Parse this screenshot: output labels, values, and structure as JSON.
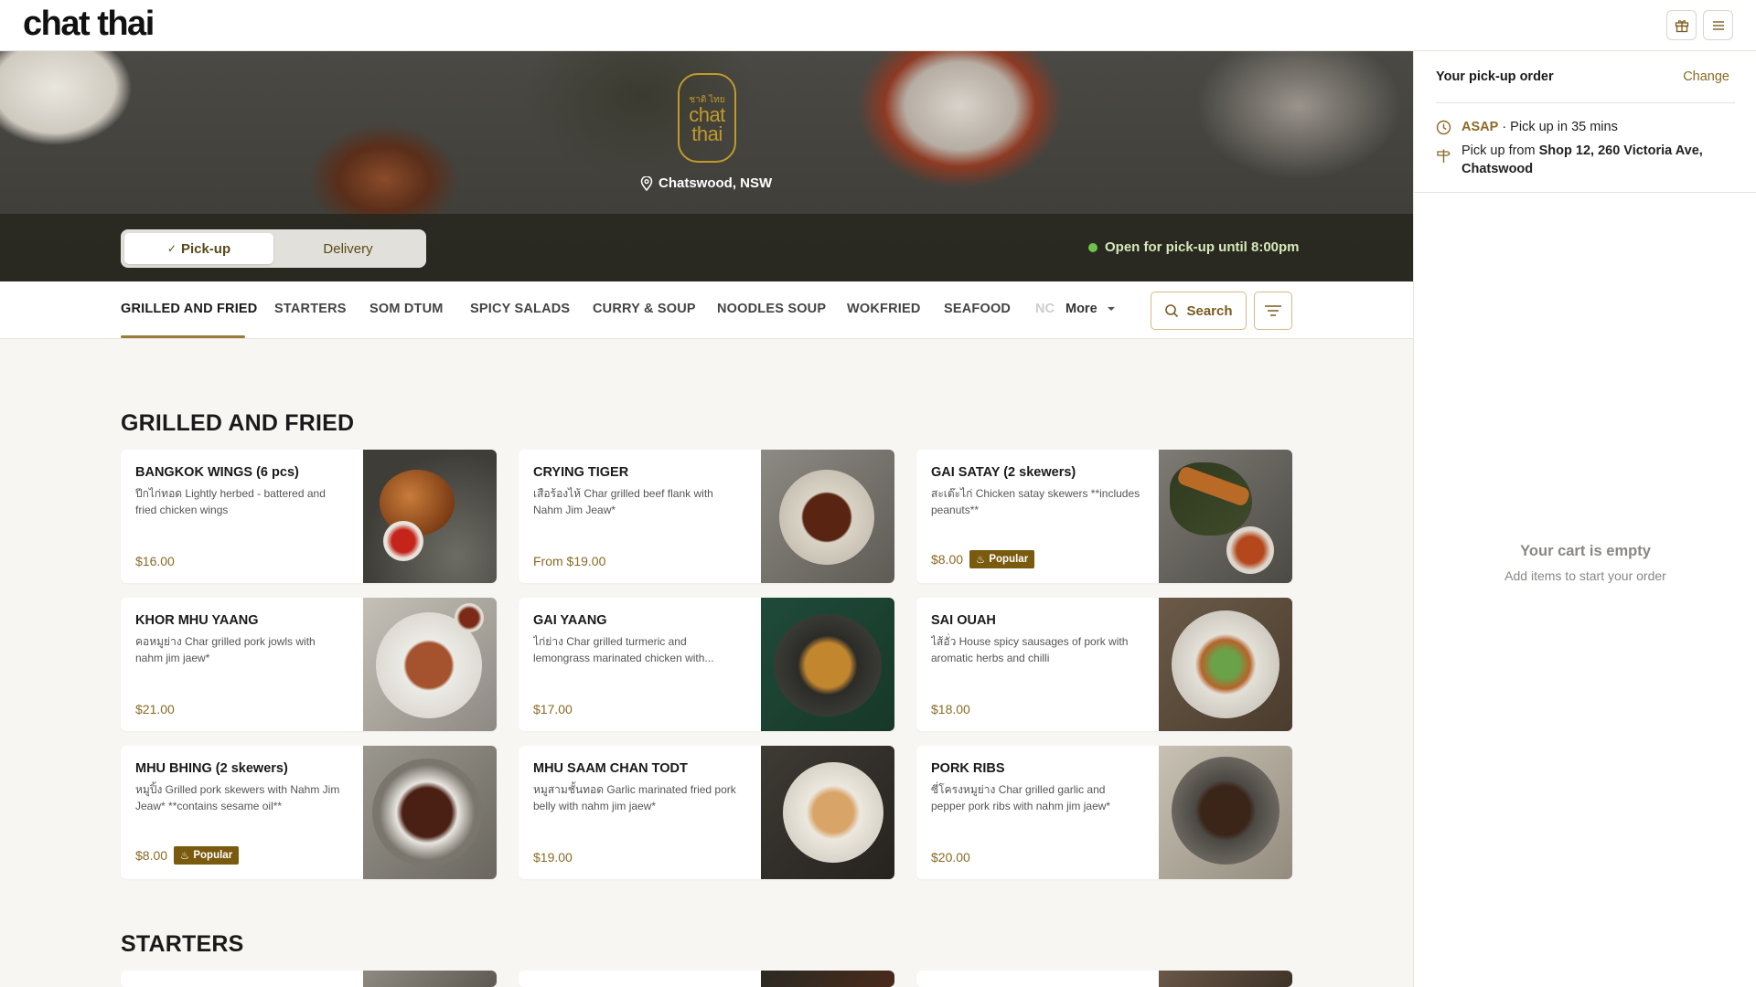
{
  "brand": {
    "name": "chat thai",
    "logo_thai": "ชาติ ไทย",
    "logo_line1": "chat",
    "logo_line2": "thai"
  },
  "header": {
    "gift_icon": "gift-icon",
    "menu_icon": "hamburger-menu-icon"
  },
  "hero": {
    "location": "Chatswood, NSW",
    "mode_pickup": "Pick-up",
    "mode_delivery": "Delivery",
    "selected_mode": "Pick-up",
    "open_status": "Open for pick-up until 8:00pm",
    "status_color": "#6cc24a"
  },
  "nav": {
    "categories": [
      "GRILLED AND FRIED",
      "STARTERS",
      "SOM DTUM",
      "SPICY SALADS",
      "CURRY & SOUP",
      "NOODLES SOUP",
      "WOKFRIED",
      "SEAFOOD"
    ],
    "truncated": "NC",
    "active": "GRILLED AND FRIED",
    "more": "More",
    "search": "Search"
  },
  "sections": {
    "grilled": {
      "title": "GRILLED AND FRIED",
      "items": [
        {
          "name": "BANGKOK WINGS (6 pcs)",
          "desc": "ปีกไก่ทอด Lightly herbed - battered and fried chicken wings",
          "price": "$16.00",
          "badge": ""
        },
        {
          "name": "CRYING TIGER",
          "desc": "เสือร้องไห้ Char grilled beef flank with Nahm Jim Jeaw*",
          "price": "From $19.00",
          "badge": ""
        },
        {
          "name": "GAI SATAY (2 skewers)",
          "desc": "สะเต๊ะไก่ Chicken satay skewers **includes peanuts**",
          "price": "$8.00",
          "badge": "Popular"
        },
        {
          "name": "KHOR MHU YAANG",
          "desc": "คอหมูย่าง Char grilled pork jowls with nahm jim jaew*",
          "price": "$21.00",
          "badge": ""
        },
        {
          "name": "GAI YAANG",
          "desc": "ไก่ย่าง Char grilled turmeric and lemongrass marinated chicken with...",
          "price": "$17.00",
          "badge": ""
        },
        {
          "name": "SAI OUAH",
          "desc": "ไส้อั่ว House spicy sausages of pork with aromatic herbs and chilli",
          "price": "$18.00",
          "badge": ""
        },
        {
          "name": "MHU BHING (2 skewers)",
          "desc": "หมูปิ้ง Grilled pork skewers with Nahm Jim Jeaw* **contains sesame oil**",
          "price": "$8.00",
          "badge": "Popular"
        },
        {
          "name": "MHU SAAM CHAN TODT",
          "desc": "หมูสามชั้นทอด Garlic marinated fried pork belly with nahm jim jaew*",
          "price": "$19.00",
          "badge": ""
        },
        {
          "name": "PORK RIBS",
          "desc": "ซี่โครงหมูย่าง Char grilled garlic and pepper pork ribs with nahm jim jaew*",
          "price": "$20.00",
          "badge": ""
        }
      ]
    },
    "starters": {
      "title": "STARTERS"
    }
  },
  "cart": {
    "title": "Your pick-up order",
    "change": "Change",
    "asap": "ASAP",
    "pickup_time": " · Pick up in 35 mins",
    "pickup_from_label": "Pick up from ",
    "pickup_address": "Shop 12, 260 Victoria Ave, Chatswood",
    "empty_title": "Your cart is empty",
    "empty_sub": "Add items to start your order"
  },
  "colors": {
    "accent": "#8a6a25",
    "badge": "#7a5a0e",
    "logo_gold": "#c29a2c"
  }
}
